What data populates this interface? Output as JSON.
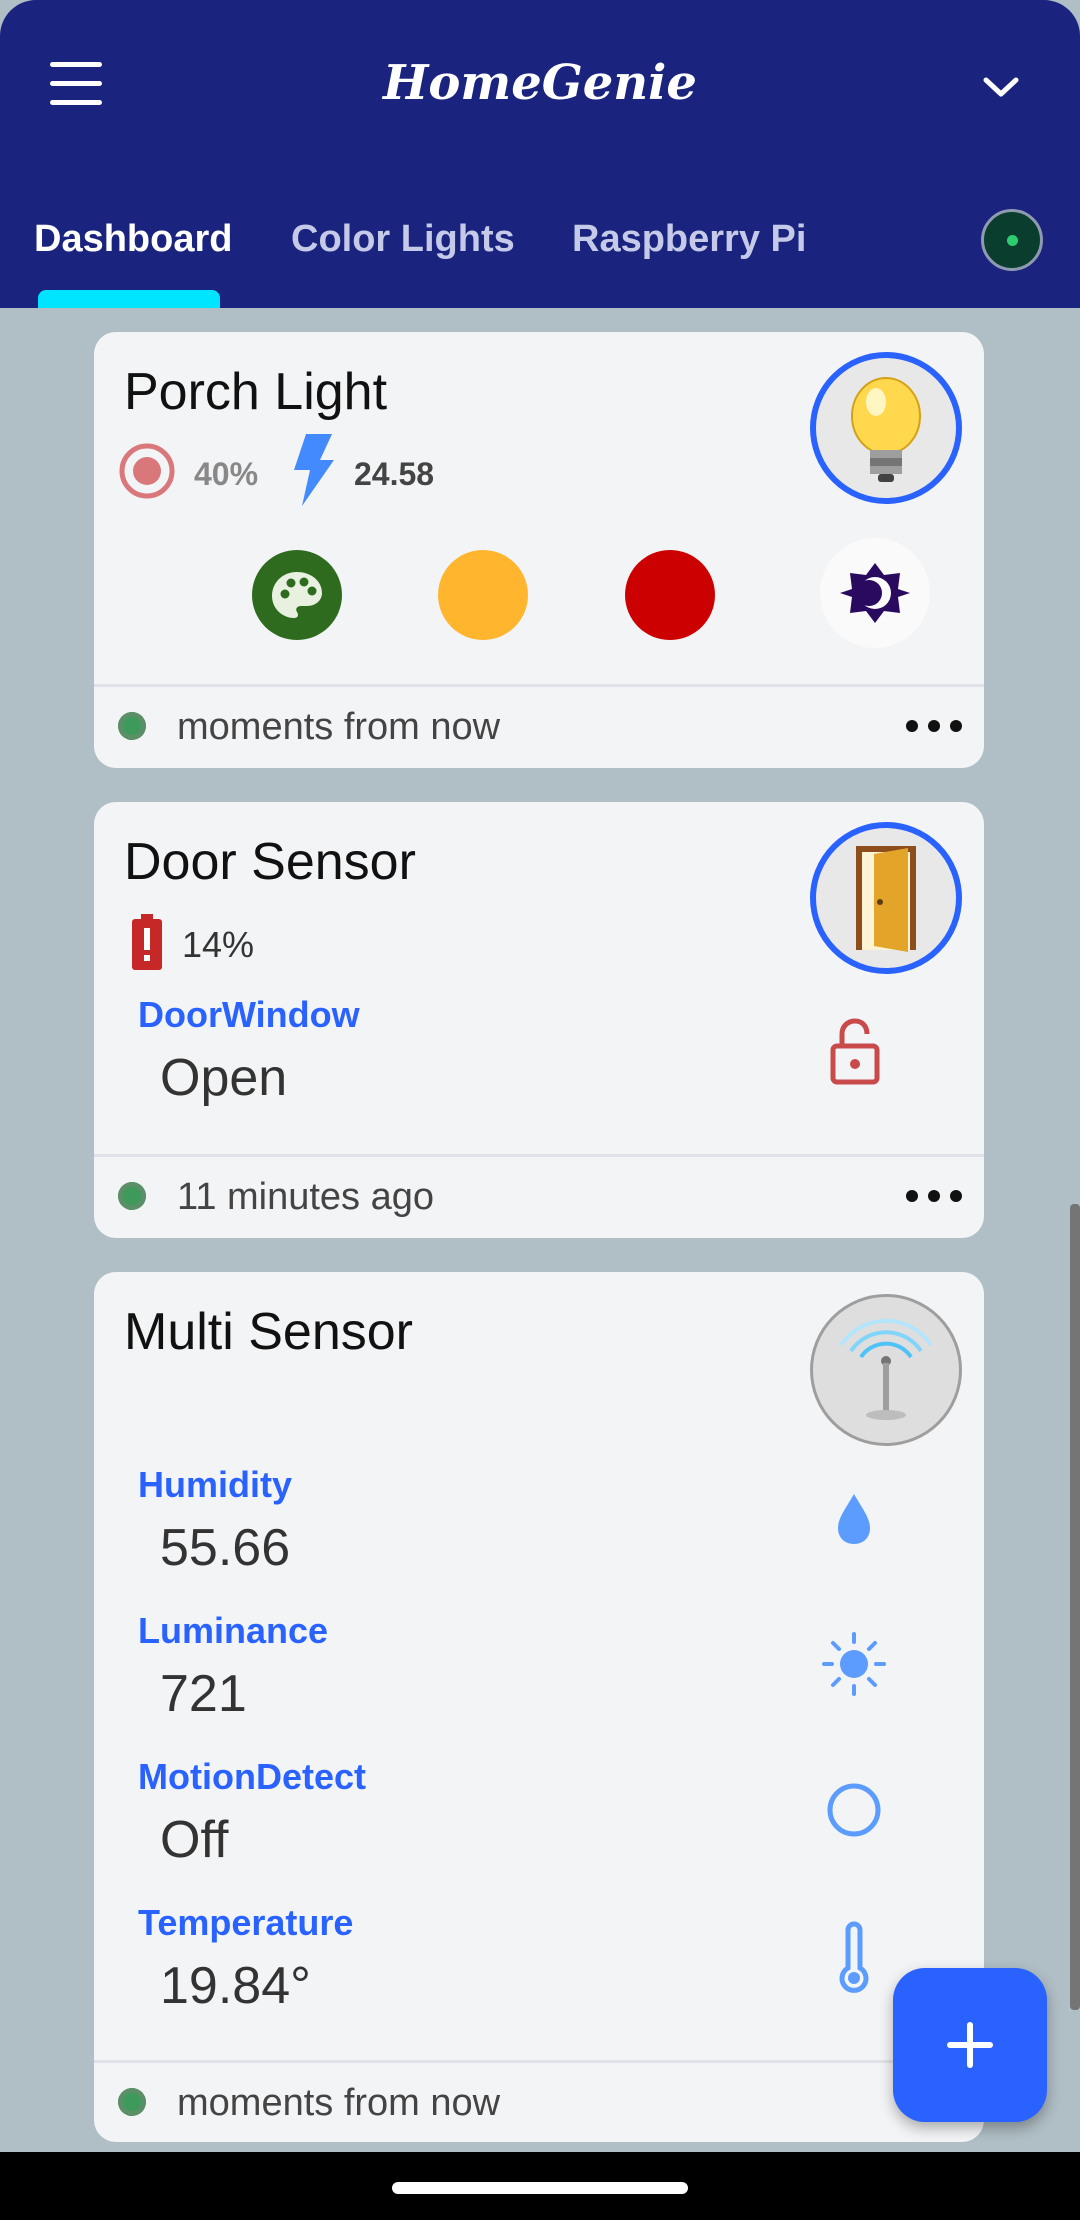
{
  "app": {
    "title": "HomeGenie"
  },
  "tabs": [
    {
      "label": "Dashboard",
      "active": true
    },
    {
      "label": "Color Lights",
      "active": false
    },
    {
      "label": "Raspberry Pi",
      "active": false
    }
  ],
  "cards": {
    "porch_light": {
      "title": "Porch Light",
      "level": "40%",
      "power": "24.58",
      "color_buttons": [
        "palette",
        "#ffb62e",
        "#cc0000"
      ],
      "footer": "moments from now"
    },
    "door_sensor": {
      "title": "Door Sensor",
      "battery": "14%",
      "property_label": "DoorWindow",
      "property_value": "Open",
      "footer": "11 minutes ago"
    },
    "multi_sensor": {
      "title": "Multi Sensor",
      "properties": [
        {
          "label": "Humidity",
          "value": "55.66",
          "icon": "water-drop-icon"
        },
        {
          "label": "Luminance",
          "value": "721",
          "icon": "sun-icon"
        },
        {
          "label": "MotionDetect",
          "value": "Off",
          "icon": "circle-outline-icon"
        },
        {
          "label": "Temperature",
          "value": "19.84°",
          "icon": "thermometer-icon"
        }
      ],
      "footer": "moments from now"
    }
  },
  "colors": {
    "appbar": "#1a237e",
    "accent": "#2962ff",
    "tab_indicator": "#00e5ff",
    "background": "#b0bec5"
  }
}
